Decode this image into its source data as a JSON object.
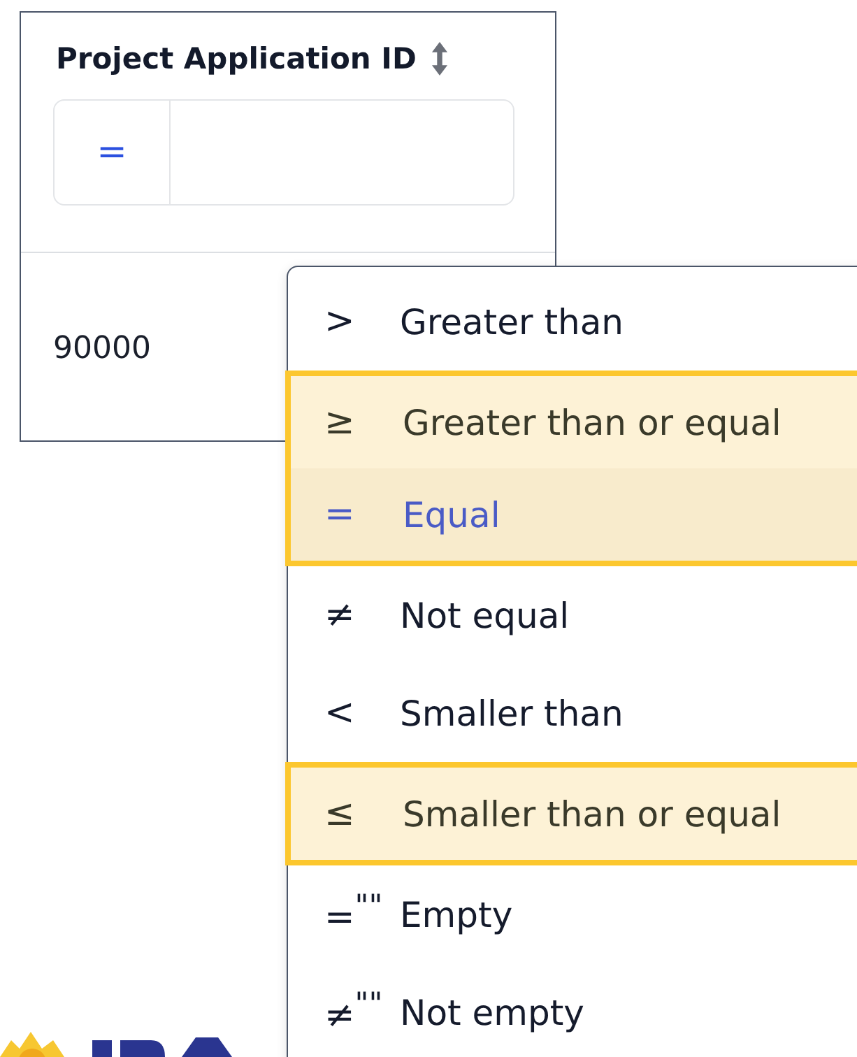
{
  "column": {
    "title": "Project Application ID",
    "sortable": true,
    "filter": {
      "operator": "="
    },
    "cells": [
      "90000"
    ]
  },
  "operator_menu": {
    "options": [
      {
        "symbol": ">",
        "label": "Greater than",
        "selected": false,
        "highlighted": false
      },
      {
        "symbol": "≥",
        "label": "Greater than or equal",
        "selected": false,
        "highlighted": true
      },
      {
        "symbol": "=",
        "label": "Equal",
        "selected": true,
        "highlighted": true
      },
      {
        "symbol": "≠",
        "label": "Not equal",
        "selected": false,
        "highlighted": false
      },
      {
        "symbol": "<",
        "label": "Smaller than",
        "selected": false,
        "highlighted": false
      },
      {
        "symbol": "≤",
        "label": "Smaller than or equal",
        "selected": false,
        "highlighted": true
      },
      {
        "symbol": "=$^{\"\"}$",
        "label": "Empty",
        "selected": false,
        "highlighted": false
      },
      {
        "symbol": "≠$^{\"\"}$",
        "label": "Not empty",
        "selected": false,
        "highlighted": false
      }
    ]
  }
}
